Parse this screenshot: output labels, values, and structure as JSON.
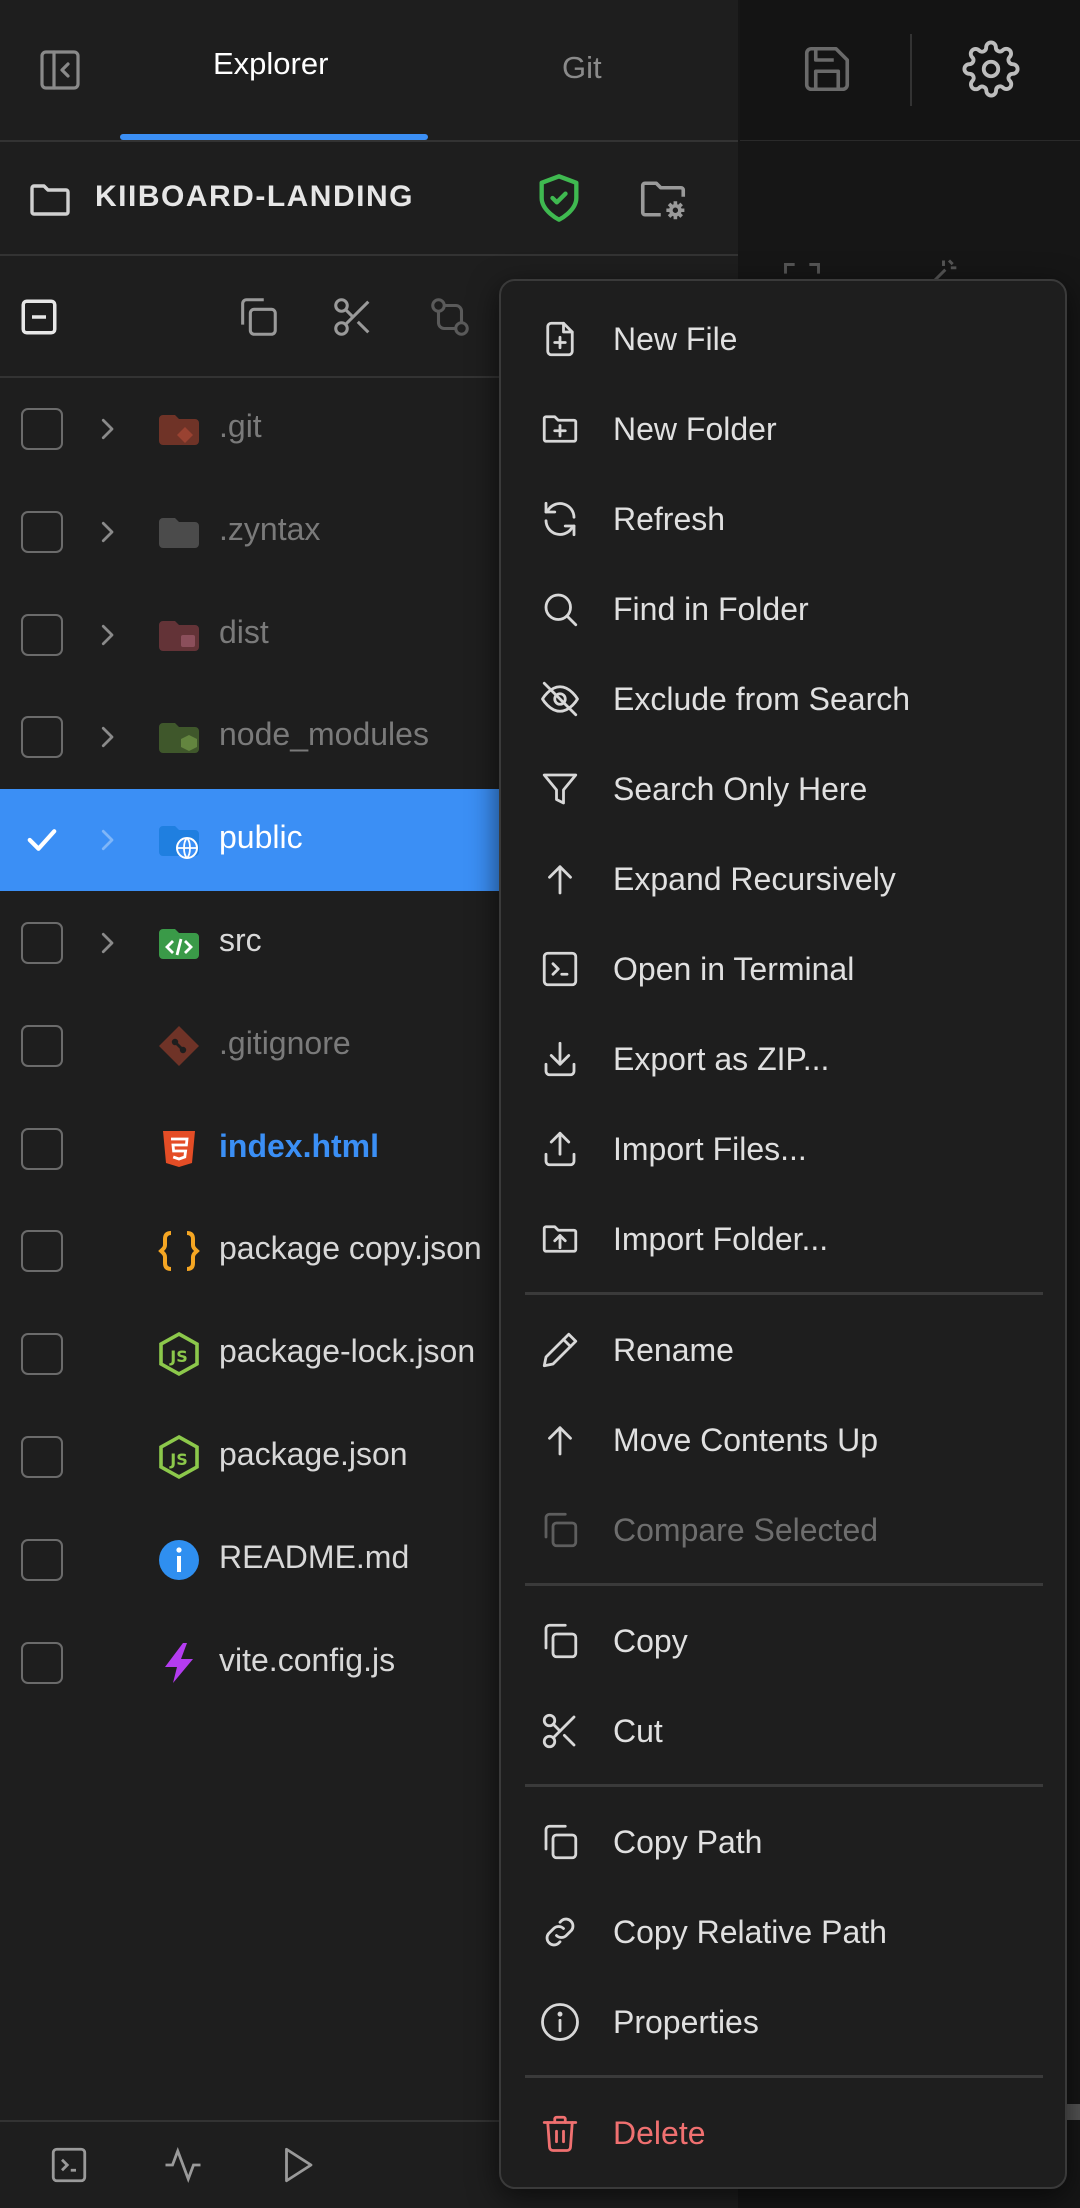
{
  "tabs": {
    "explorer": "Explorer",
    "git": "Git",
    "active": "Explorer"
  },
  "project": {
    "name": "KIIBOARD-LANDING"
  },
  "colors": {
    "accent": "#3b8ff5",
    "selected_row": "#3b8ff5",
    "shield": "#3fb950",
    "danger": "#f07070",
    "html_orange": "#e44d26",
    "json_yellow": "#f5a623",
    "node_green": "#8cc84b",
    "vite_purple": "#a23bf5"
  },
  "tree": {
    "items": [
      {
        "name": ".git",
        "type": "folder",
        "icon": "git-folder-icon",
        "dimmed": true,
        "selected": false
      },
      {
        "name": ".zyntax",
        "type": "folder",
        "icon": "folder-icon",
        "dimmed": true,
        "selected": false
      },
      {
        "name": "dist",
        "type": "folder",
        "icon": "dist-folder-icon",
        "dimmed": true,
        "selected": false
      },
      {
        "name": "node_modules",
        "type": "folder",
        "icon": "node-folder-icon",
        "dimmed": true,
        "selected": false
      },
      {
        "name": "public",
        "type": "folder",
        "icon": "public-folder-icon",
        "dimmed": false,
        "selected": true
      },
      {
        "name": "src",
        "type": "folder",
        "icon": "src-folder-icon",
        "dimmed": false,
        "selected": false
      },
      {
        "name": ".gitignore",
        "type": "file",
        "icon": "git-file-icon",
        "dimmed": true,
        "selected": false
      },
      {
        "name": "index.html",
        "type": "file",
        "icon": "html5-icon",
        "dimmed": false,
        "selected": false,
        "highlight": true
      },
      {
        "name": "package copy.json",
        "type": "file",
        "icon": "json-braces-icon",
        "dimmed": false,
        "selected": false
      },
      {
        "name": "package-lock.json",
        "type": "file",
        "icon": "nodejs-icon",
        "dimmed": false,
        "selected": false
      },
      {
        "name": "package.json",
        "type": "file",
        "icon": "nodejs-icon",
        "dimmed": false,
        "selected": false
      },
      {
        "name": "README.md",
        "type": "file",
        "icon": "info-icon",
        "dimmed": false,
        "selected": false
      },
      {
        "name": "vite.config.js",
        "type": "file",
        "icon": "vite-icon",
        "dimmed": false,
        "selected": false
      }
    ]
  },
  "context_menu": {
    "items": [
      {
        "label": "New File",
        "icon": "new-file-icon"
      },
      {
        "label": "New Folder",
        "icon": "new-folder-icon"
      },
      {
        "label": "Refresh",
        "icon": "refresh-icon"
      },
      {
        "label": "Find in Folder",
        "icon": "search-icon"
      },
      {
        "label": "Exclude from Search",
        "icon": "eye-off-icon"
      },
      {
        "label": "Search Only Here",
        "icon": "filter-icon"
      },
      {
        "label": "Expand Recursively",
        "icon": "arrow-up-icon"
      },
      {
        "label": "Open in Terminal",
        "icon": "terminal-icon"
      },
      {
        "label": "Export as ZIP...",
        "icon": "download-icon"
      },
      {
        "label": "Import Files...",
        "icon": "upload-icon"
      },
      {
        "label": "Import Folder...",
        "icon": "folder-upload-icon"
      },
      {
        "label": "Rename",
        "icon": "pencil-icon"
      },
      {
        "label": "Move Contents Up",
        "icon": "arrow-up-icon"
      },
      {
        "label": "Compare Selected",
        "icon": "copy-icon",
        "disabled": true
      },
      {
        "label": "Copy",
        "icon": "copy-icon"
      },
      {
        "label": "Cut",
        "icon": "scissors-icon"
      },
      {
        "label": "Copy Path",
        "icon": "copy-icon"
      },
      {
        "label": "Copy Relative Path",
        "icon": "link-icon"
      },
      {
        "label": "Properties",
        "icon": "info-circle-icon"
      },
      {
        "label": "Delete",
        "icon": "trash-icon",
        "danger": true
      }
    ]
  }
}
